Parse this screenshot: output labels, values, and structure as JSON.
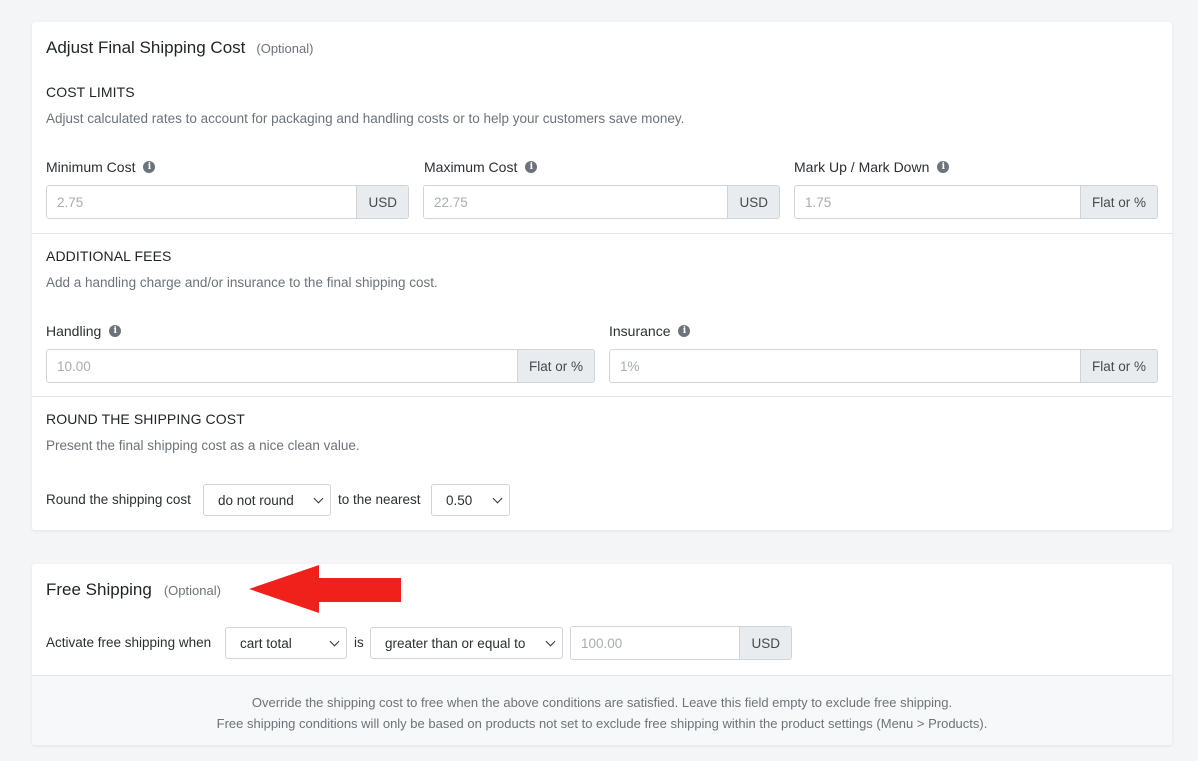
{
  "adjust": {
    "title": "Adjust Final Shipping Cost",
    "optional": "(Optional)",
    "cost_limits": {
      "heading": "COST LIMITS",
      "description": "Adjust calculated rates to account for packaging and handling costs or to help your customers save money.",
      "minimum": {
        "label": "Minimum Cost",
        "placeholder": "2.75",
        "addon": "USD"
      },
      "maximum": {
        "label": "Maximum Cost",
        "placeholder": "22.75",
        "addon": "USD"
      },
      "markup": {
        "label": "Mark Up / Mark Down",
        "placeholder": "1.75",
        "addon": "Flat or %"
      }
    },
    "additional_fees": {
      "heading": "ADDITIONAL FEES",
      "description": "Add a handling charge and/or insurance to the final shipping cost.",
      "handling": {
        "label": "Handling",
        "placeholder": "10.00",
        "addon": "Flat or %"
      },
      "insurance": {
        "label": "Insurance",
        "placeholder": "1%",
        "addon": "Flat or %"
      }
    },
    "rounding": {
      "heading": "ROUND THE SHIPPING COST",
      "description": "Present the final shipping cost as a nice clean value.",
      "prefix": "Round the shipping cost",
      "mode": "do not round",
      "middle": "to the nearest",
      "nearest": "0.50"
    }
  },
  "free_shipping": {
    "title": "Free Shipping",
    "optional": "(Optional)",
    "prefix": "Activate free shipping when",
    "condition_field": "cart total",
    "is_text": "is",
    "operator": "greater than or equal to",
    "amount_placeholder": "100.00",
    "amount_addon": "USD",
    "note_line1": "Override the shipping cost to free when the above conditions are satisfied. Leave this field empty to exclude free shipping.",
    "note_line2": "Free shipping conditions will only be based on products not set to exclude free shipping within the product settings (Menu > Products)."
  },
  "colors": {
    "arrow": "#f0201a",
    "page_bg": "#f4f5f7"
  },
  "icons": {
    "info": "info-circle-icon",
    "chevron": "chevron-down-icon",
    "arrow": "red-arrow-left-icon"
  }
}
